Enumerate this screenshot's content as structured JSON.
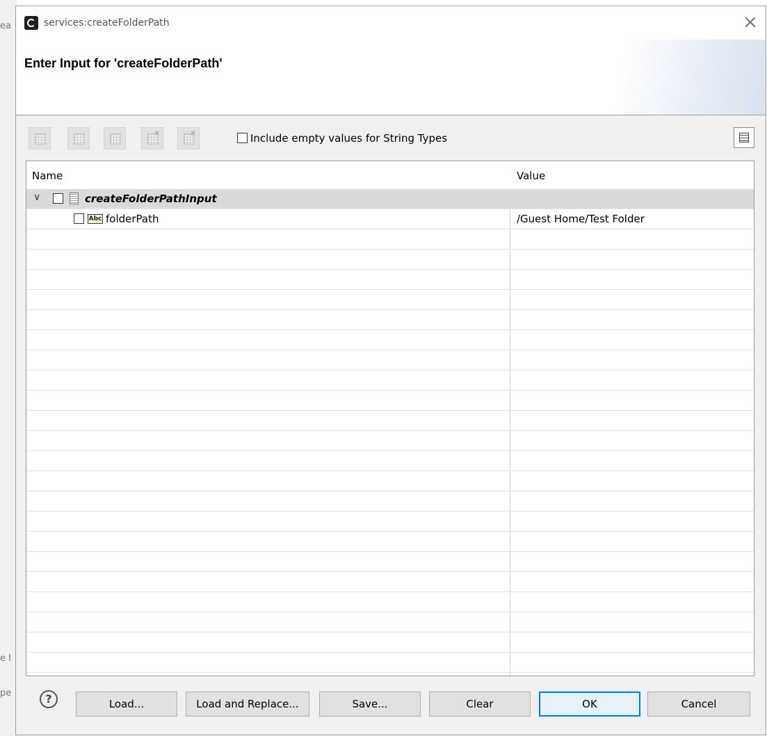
{
  "background_window": {
    "fragments": [
      "ea",
      "e I",
      "pe"
    ]
  },
  "window": {
    "title": "services:createFolderPath",
    "close_glyph": "×"
  },
  "header": {
    "title": "Enter Input for 'createFolderPath'"
  },
  "toolbar": {
    "buttons": [
      "add-row-icon",
      "insert-row-icon",
      "add-column-icon",
      "remove-row-icon",
      "remove-column-icon"
    ],
    "include_empty_label": "Include empty values for String Types",
    "include_empty_checked": false,
    "layout_button_icon": "table-layout-icon"
  },
  "table": {
    "columns": [
      "Name",
      "Value"
    ],
    "rows": [
      {
        "name": "createFolderPathInput",
        "value": "",
        "expanded": true,
        "level": 0,
        "icon": "document-icon"
      },
      {
        "name": "folderPath",
        "value": "/Guest Home/Test Folder",
        "level": 1,
        "icon": "abc-string-icon",
        "icon_text": "Abc"
      }
    ],
    "chevron_glyph": "∨"
  },
  "footer": {
    "help_glyph": "?",
    "buttons": {
      "load": "Load...",
      "load_replace": "Load and Replace...",
      "save": "Save...",
      "clear": "Clear",
      "ok": "OK",
      "cancel": "Cancel"
    }
  }
}
